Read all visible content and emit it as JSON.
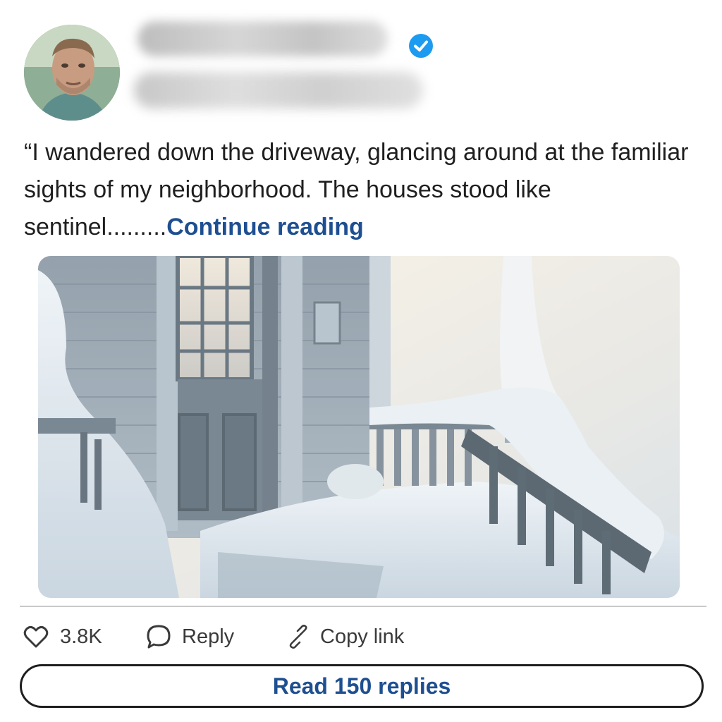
{
  "post": {
    "text": "“I wandered down the driveway, glancing around at the familiar sights of my neighborhood. The houses stood like sentinel.........",
    "continue_label": "Continue reading"
  },
  "actions": {
    "likes_count": "3.8K",
    "reply_label": "Reply",
    "copy_link_label": "Copy link"
  },
  "read_replies_label": "Read 150 replies",
  "colors": {
    "link": "#1e4f91",
    "verified": "#1d9bf0"
  }
}
